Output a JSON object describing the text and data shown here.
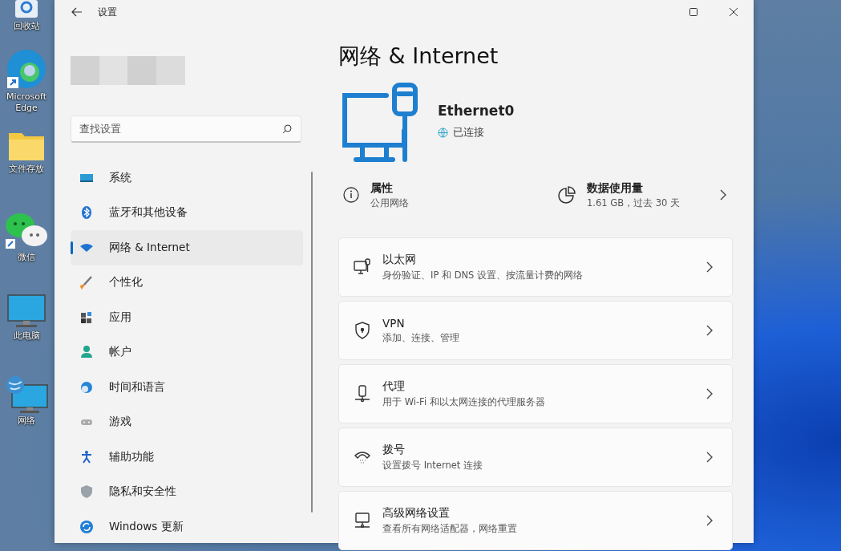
{
  "desktop_icons": [
    {
      "label": "回收站",
      "kind": "recycle"
    },
    {
      "label": "Microsoft Edge",
      "kind": "edge"
    },
    {
      "label": "文件存放",
      "kind": "folder"
    },
    {
      "label": "微信",
      "kind": "chat"
    },
    {
      "label": "此电脑",
      "kind": "pc"
    },
    {
      "label": "网络",
      "kind": "network"
    }
  ],
  "window": {
    "title": "设置"
  },
  "sidebar": {
    "search": {
      "placeholder": "查找设置"
    },
    "items": [
      {
        "label": "系统",
        "kind": "system",
        "selected": false
      },
      {
        "label": "蓝牙和其他设备",
        "kind": "bluetooth",
        "selected": false
      },
      {
        "label": "网络 & Internet",
        "kind": "network",
        "selected": true
      },
      {
        "label": "个性化",
        "kind": "brush",
        "selected": false
      },
      {
        "label": "应用",
        "kind": "apps",
        "selected": false
      },
      {
        "label": "帐户",
        "kind": "account",
        "selected": false
      },
      {
        "label": "时间和语言",
        "kind": "time",
        "selected": false
      },
      {
        "label": "游戏",
        "kind": "gaming",
        "selected": false
      },
      {
        "label": "辅助功能",
        "kind": "accessibility",
        "selected": false
      },
      {
        "label": "隐私和安全性",
        "kind": "privacy",
        "selected": false
      },
      {
        "label": "Windows 更新",
        "kind": "update",
        "selected": false
      }
    ]
  },
  "page": {
    "title": "网络 & Internet",
    "device": {
      "name": "Ethernet0",
      "status": "已连接"
    },
    "properties": {
      "title": "属性",
      "subtitle": "公用网络"
    },
    "data_usage": {
      "title": "数据使用量",
      "subtitle": "1.61 GB，过去 30 天"
    },
    "cards": [
      {
        "kind": "ethernet",
        "title": "以太网",
        "subtitle": "身份验证、IP 和 DNS 设置、按流量计费的网络"
      },
      {
        "kind": "vpn",
        "title": "VPN",
        "subtitle": "添加、连接、管理"
      },
      {
        "kind": "proxy",
        "title": "代理",
        "subtitle": "用于 Wi-Fi 和以太网连接的代理服务器"
      },
      {
        "kind": "dialup",
        "title": "拨号",
        "subtitle": "设置拨号 Internet 连接"
      },
      {
        "kind": "advanced",
        "title": "高级网络设置",
        "subtitle": "查看所有网络适配器，网络重置"
      }
    ]
  }
}
